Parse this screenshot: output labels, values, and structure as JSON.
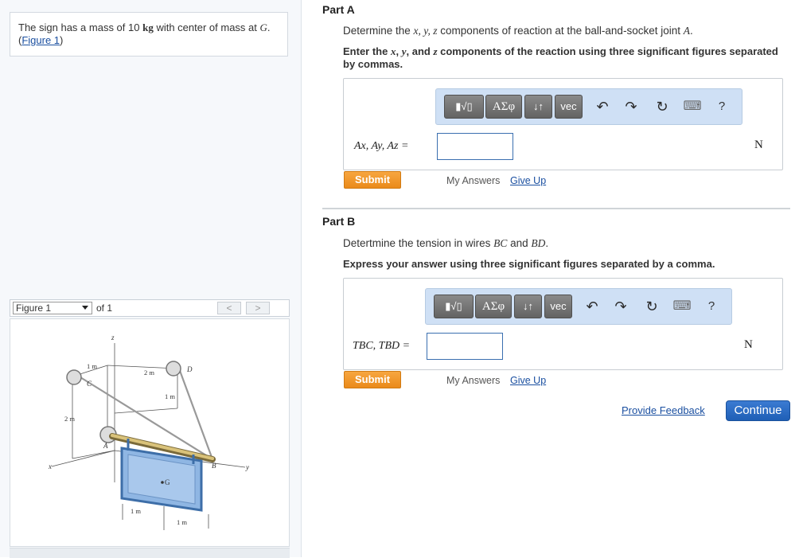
{
  "left": {
    "intro_text": "The sign has a mass of 10 kg with center of mass at G.",
    "intro_text_prefix": "The sign has a mass of 10 ",
    "mass_unit": "kg",
    "intro_mid": " with center of mass at ",
    "intro_point": "G",
    "intro_end": ".",
    "figure_link_open": "(",
    "figure_link": "Figure 1",
    "figure_link_close": ")",
    "figure_select": "Figure 1",
    "figure_of": "of 1",
    "prev": "<",
    "next": ">"
  },
  "figure": {
    "labels": {
      "z": "z",
      "x": "x",
      "y": "y",
      "A": "A",
      "B": "B",
      "C": "C",
      "D": "D",
      "G": "G",
      "d1": "1 m",
      "d2": "2 m",
      "d3": "1 m",
      "d4": "2 m",
      "d5": "1 m",
      "d6": "1 m"
    }
  },
  "partA": {
    "title": "Part A",
    "prompt_pre": "Determine the ",
    "prompt_vars": "x, y, z",
    "prompt_post": " components of reaction at the ball-and-socket joint ",
    "prompt_joint": "A",
    "prompt_end": ".",
    "instruction": "Enter the x, y, and z components of the reaction using three significant figures separated by commas.",
    "instr_l1_a": "Enter the ",
    "instr_x": "x",
    "instr_sep1": ", ",
    "instr_y": "y",
    "instr_sep2": ", and ",
    "instr_z": "z",
    "instr_l1_b": " components of the reaction using three significant figures separated",
    "instr_l2": "by commas.",
    "expression": "Ax, Ay, Az =",
    "unit": "N",
    "submit": "Submit",
    "my_answers": "My Answers",
    "give_up": "Give Up"
  },
  "partB": {
    "title": "Part B",
    "prompt_pre": "Detertmine the tension in wires ",
    "prompt_w1": "BC",
    "prompt_and": " and ",
    "prompt_w2": "BD",
    "prompt_end": ".",
    "instruction": "Express your answer using three significant figures separated by a comma.",
    "expression": "TBC, TBD =",
    "unit": "N",
    "submit": "Submit",
    "my_answers": "My Answers",
    "give_up": "Give Up"
  },
  "toolbar": {
    "templates": "▮√▯",
    "symbols": "ΑΣφ",
    "arrows": "↓↑",
    "vec": "vec",
    "undo": "↶",
    "redo": "↷",
    "reset": "↻",
    "keyboard": "⌨",
    "help": "?"
  },
  "footer": {
    "feedback": "Provide Feedback",
    "continue": "Continue"
  }
}
